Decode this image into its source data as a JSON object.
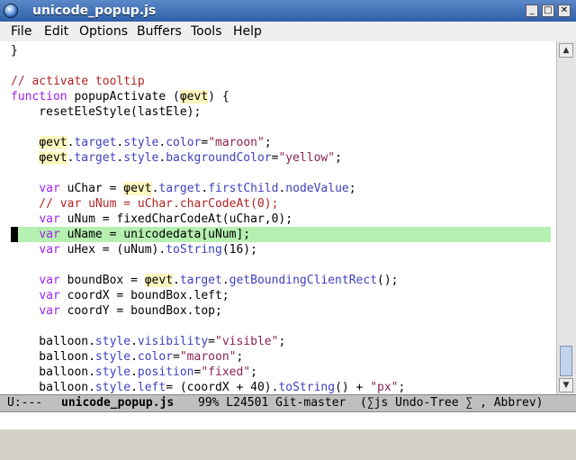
{
  "window": {
    "title": "unicode_popup.js",
    "minimize_glyph": "_",
    "maximize_glyph": "□",
    "close_glyph": "✕"
  },
  "menu": [
    "File",
    "Edit",
    "Options",
    "Buffers",
    "Tools",
    "Help"
  ],
  "colors": {
    "keyword": "#a020f0",
    "string": "#8b2252",
    "comment": "#b22222",
    "property": "#4040c0",
    "highlight_line": "#b6f0b0"
  },
  "code": {
    "highlighted_line_index": 12,
    "lines": [
      [
        {
          "t": "}"
        }
      ],
      [],
      [
        {
          "t": "// activate tooltip",
          "c": "cm"
        }
      ],
      [
        {
          "t": "function",
          "c": "kw"
        },
        {
          "t": " popupActivate ("
        },
        {
          "t": "φevt",
          "c": "phi"
        },
        {
          "t": ") {"
        }
      ],
      [
        {
          "t": "    resetEleStyle(lastEle);"
        }
      ],
      [],
      [
        {
          "t": "    "
        },
        {
          "t": "φevt",
          "c": "phi"
        },
        {
          "t": "."
        },
        {
          "t": "target",
          "c": "prop"
        },
        {
          "t": "."
        },
        {
          "t": "style",
          "c": "prop"
        },
        {
          "t": "."
        },
        {
          "t": "color",
          "c": "prop"
        },
        {
          "t": "="
        },
        {
          "t": "\"maroon\"",
          "c": "str"
        },
        {
          "t": ";"
        }
      ],
      [
        {
          "t": "    "
        },
        {
          "t": "φevt",
          "c": "phi"
        },
        {
          "t": "."
        },
        {
          "t": "target",
          "c": "prop"
        },
        {
          "t": "."
        },
        {
          "t": "style",
          "c": "prop"
        },
        {
          "t": "."
        },
        {
          "t": "backgroundColor",
          "c": "prop"
        },
        {
          "t": "="
        },
        {
          "t": "\"yellow\"",
          "c": "str"
        },
        {
          "t": ";"
        }
      ],
      [],
      [
        {
          "t": "    "
        },
        {
          "t": "var",
          "c": "kw"
        },
        {
          "t": " uChar = "
        },
        {
          "t": "φevt",
          "c": "phi"
        },
        {
          "t": "."
        },
        {
          "t": "target",
          "c": "prop"
        },
        {
          "t": "."
        },
        {
          "t": "firstChild",
          "c": "prop"
        },
        {
          "t": "."
        },
        {
          "t": "nodeValue",
          "c": "prop"
        },
        {
          "t": ";"
        }
      ],
      [
        {
          "t": "    // var uNum = uChar.charCodeAt(0);",
          "c": "cm"
        }
      ],
      [
        {
          "t": "    "
        },
        {
          "t": "var",
          "c": "kw"
        },
        {
          "t": " uNum = fixedCharCodeAt(uChar,0);"
        }
      ],
      [
        {
          "t": "    "
        },
        {
          "t": "var",
          "c": "kw"
        },
        {
          "t": " uName = unicodedata[uNum];"
        }
      ],
      [
        {
          "t": "    "
        },
        {
          "t": "var",
          "c": "kw"
        },
        {
          "t": " uHex = (uNum)."
        },
        {
          "t": "toString",
          "c": "prop"
        },
        {
          "t": "(16);"
        }
      ],
      [],
      [
        {
          "t": "    "
        },
        {
          "t": "var",
          "c": "kw"
        },
        {
          "t": " boundBox = "
        },
        {
          "t": "φevt",
          "c": "phi"
        },
        {
          "t": "."
        },
        {
          "t": "target",
          "c": "prop"
        },
        {
          "t": "."
        },
        {
          "t": "getBoundingClientRect",
          "c": "prop"
        },
        {
          "t": "();"
        }
      ],
      [
        {
          "t": "    "
        },
        {
          "t": "var",
          "c": "kw"
        },
        {
          "t": " coordX = boundBox.left;"
        }
      ],
      [
        {
          "t": "    "
        },
        {
          "t": "var",
          "c": "kw"
        },
        {
          "t": " coordY = boundBox.top;"
        }
      ],
      [],
      [
        {
          "t": "    balloon."
        },
        {
          "t": "style",
          "c": "prop"
        },
        {
          "t": "."
        },
        {
          "t": "visibility",
          "c": "prop"
        },
        {
          "t": "="
        },
        {
          "t": "\"visible\"",
          "c": "str"
        },
        {
          "t": ";"
        }
      ],
      [
        {
          "t": "    balloon."
        },
        {
          "t": "style",
          "c": "prop"
        },
        {
          "t": "."
        },
        {
          "t": "color",
          "c": "prop"
        },
        {
          "t": "="
        },
        {
          "t": "\"maroon\"",
          "c": "str"
        },
        {
          "t": ";"
        }
      ],
      [
        {
          "t": "    balloon."
        },
        {
          "t": "style",
          "c": "prop"
        },
        {
          "t": "."
        },
        {
          "t": "position",
          "c": "prop"
        },
        {
          "t": "="
        },
        {
          "t": "\"fixed\"",
          "c": "str"
        },
        {
          "t": ";"
        }
      ],
      [
        {
          "t": "    balloon."
        },
        {
          "t": "style",
          "c": "prop"
        },
        {
          "t": "."
        },
        {
          "t": "left",
          "c": "prop"
        },
        {
          "t": "= (coordX + 40)."
        },
        {
          "t": "toString",
          "c": "prop"
        },
        {
          "t": "() + "
        },
        {
          "t": "\"px\"",
          "c": "str"
        },
        {
          "t": ";"
        }
      ]
    ]
  },
  "modeline": {
    "status": "U:---",
    "buffer": "unicode_popup.js",
    "rest": "99% L24501 Git-master  (∑js Undo-Tree ∑ , Abbrev)"
  }
}
